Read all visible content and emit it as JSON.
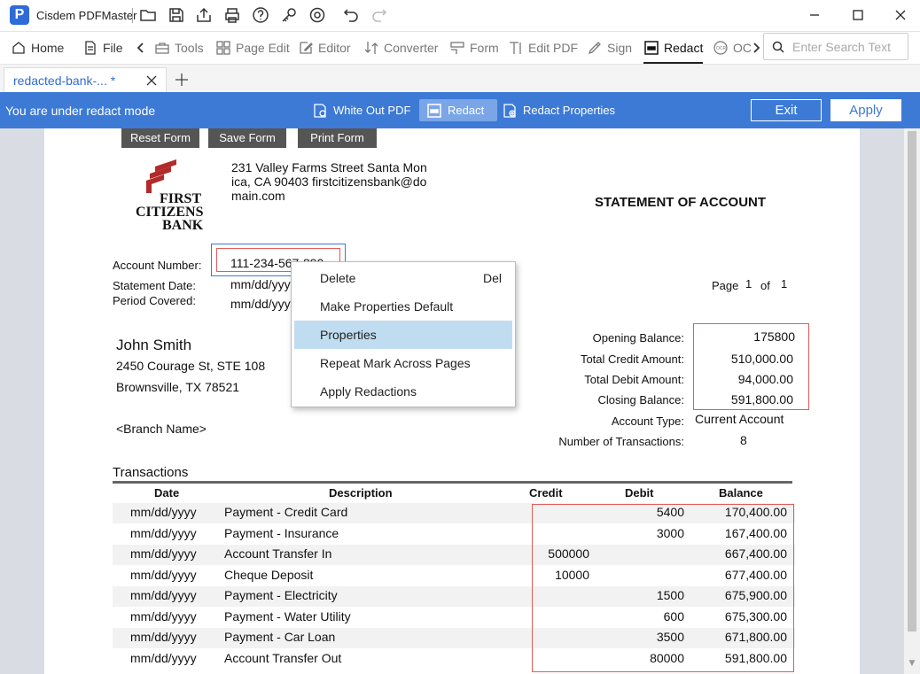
{
  "app": {
    "title": "Cisdem PDFMaster"
  },
  "menu": {
    "items": [
      {
        "label": "Home",
        "icon": "home-icon"
      },
      {
        "label": "File",
        "icon": "file-icon"
      },
      {
        "label": "Tools",
        "icon": "toolbox-icon"
      },
      {
        "label": "Page Edit",
        "icon": "grid-icon"
      },
      {
        "label": "Editor",
        "icon": "pencil-icon"
      },
      {
        "label": "Converter",
        "icon": "convert-icon"
      },
      {
        "label": "Form",
        "icon": "form-icon"
      },
      {
        "label": "Edit PDF",
        "icon": "text-cursor-icon"
      },
      {
        "label": "Sign",
        "icon": "sign-icon"
      },
      {
        "label": "Redact",
        "icon": "redact-icon"
      },
      {
        "label": "OC",
        "icon": "ocr-icon"
      }
    ],
    "search_placeholder": "Enter Search Text"
  },
  "tab": {
    "label": "redacted-bank-... *"
  },
  "redact_bar": {
    "mode_text": "You are under redact mode",
    "white_out": "White Out PDF",
    "redact": "Redact",
    "properties": "Redact Properties",
    "exit": "Exit",
    "apply": "Apply"
  },
  "doc": {
    "form_buttons": [
      "Reset Form",
      "Save Form",
      "Print Form"
    ],
    "bank_logo": [
      "FIRST",
      "CITIZENS",
      "BANK"
    ],
    "address_lines": [
      "231 Valley Farms Street Santa Mon",
      "ica, CA 90403 firstcitizensbank@do",
      "main.com"
    ],
    "title": "STATEMENT OF ACCOUNT",
    "account_number_label": "Account Number:",
    "account_number_value": "111-234-567-890",
    "statement_date_label": "Statement Date:",
    "statement_date_value": "mm/dd/yyyy",
    "period_label": "Period Covered:",
    "period_value": "mm/dd/yyyy",
    "page_label": "Page",
    "page_num": "1",
    "page_of": "of",
    "page_total": "1",
    "customer_name": "John Smith",
    "customer_addr1": "2450 Courage St, STE 108",
    "customer_addr2": "Brownsville, TX 78521",
    "branch": "<Branch Name>",
    "summary": [
      {
        "label": "Opening Balance:",
        "value": "175800"
      },
      {
        "label": "Total Credit Amount:",
        "value": "510,000.00"
      },
      {
        "label": "Total Debit Amount:",
        "value": "94,000.00"
      },
      {
        "label": "Closing Balance:",
        "value": "591,800.00"
      }
    ],
    "account_type_label": "Account Type:",
    "account_type_value": "Current Account",
    "num_txn_label": "Number of Transactions:",
    "num_txn_value": "8",
    "transactions_heading": "Transactions",
    "columns": [
      "Date",
      "Description",
      "Credit",
      "Debit",
      "Balance"
    ],
    "rows": [
      {
        "date": "mm/dd/yyyy",
        "desc": "Payment - Credit Card",
        "credit": "",
        "debit": "5400",
        "balance": "170,400.00"
      },
      {
        "date": "mm/dd/yyyy",
        "desc": "Payment - Insurance",
        "credit": "",
        "debit": "3000",
        "balance": "167,400.00"
      },
      {
        "date": "mm/dd/yyyy",
        "desc": "Account Transfer In",
        "credit": "500000",
        "debit": "",
        "balance": "667,400.00"
      },
      {
        "date": "mm/dd/yyyy",
        "desc": "Cheque Deposit",
        "credit": "10000",
        "debit": "",
        "balance": "677,400.00"
      },
      {
        "date": "mm/dd/yyyy",
        "desc": "Payment - Electricity",
        "credit": "",
        "debit": "1500",
        "balance": "675,900.00"
      },
      {
        "date": "mm/dd/yyyy",
        "desc": "Payment - Water Utility",
        "credit": "",
        "debit": "600",
        "balance": "675,300.00"
      },
      {
        "date": "mm/dd/yyyy",
        "desc": "Payment - Car Loan",
        "credit": "",
        "debit": "3500",
        "balance": "671,800.00"
      },
      {
        "date": "mm/dd/yyyy",
        "desc": "Account Transfer Out",
        "credit": "",
        "debit": "80000",
        "balance": "591,800.00"
      }
    ]
  },
  "context_menu": {
    "items": [
      {
        "label": "Delete",
        "shortcut": "Del"
      },
      {
        "label": "Make Properties Default",
        "shortcut": ""
      },
      {
        "label": "Properties",
        "shortcut": ""
      },
      {
        "label": "Repeat Mark Across Pages",
        "shortcut": ""
      },
      {
        "label": "Apply Redactions",
        "shortcut": ""
      }
    ]
  }
}
